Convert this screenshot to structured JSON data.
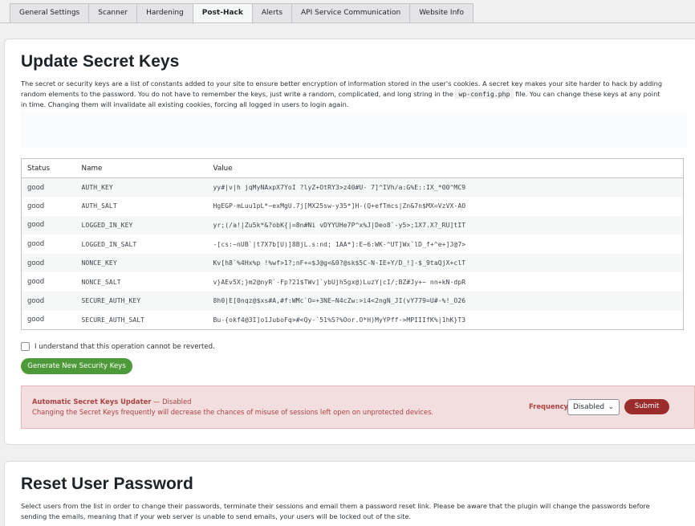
{
  "tabs": [
    {
      "label": "General Settings"
    },
    {
      "label": "Scanner"
    },
    {
      "label": "Hardening"
    },
    {
      "label": "Post-Hack"
    },
    {
      "label": "Alerts"
    },
    {
      "label": "API Service Communication"
    },
    {
      "label": "Website Info"
    }
  ],
  "active_tab": "Post-Hack",
  "secret_keys": {
    "title": "Update Secret Keys",
    "desc_part1": "The secret or security keys are a list of constants added to your site to ensure better encryption of information stored in the user's cookies. A secret key makes your site harder to hack by adding random elements to the password. You do not have to remember the keys, just write a random, complicated, and long string in the ",
    "desc_code": "wp-config.php",
    "desc_part2": " file. You can change these keys at any point in time. Changing them will invalidate all existing cookies, forcing all logged in users to login again.",
    "columns": [
      "Status",
      "Name",
      "Value"
    ],
    "rows": [
      {
        "status": "good",
        "name": "AUTH_KEY",
        "value": "yy#|v|h jqMyNAxpX7YoI ?lyZ+OtRY3>z40#U- 7]^IVh/a:G%E::IX_*00^MC9"
      },
      {
        "status": "good",
        "name": "AUTH_SALT",
        "value": "HgEGP-mLuu1pL*~exMgU.7j[MX25sw-y35*]H-(Q+efTmcs|Zn&7n$MX=VzVX-AO"
      },
      {
        "status": "good",
        "name": "LOGGED_IN_KEY",
        "value": "yr;(/a!|Zu5k*&?obK{|=8n#Ni vDYYUHe7P^x%J|Deo8`-y5>;1X7.X?_RU]tIT"
      },
      {
        "status": "good",
        "name": "LOGGED_IN_SALT",
        "value": "-[cs:~nUB`|t7X7b[U)]8BjL.s:nd; 1AA*]:E~6:WK-^UT]Wx`lD_f+^e+]J@7>"
      },
      {
        "status": "good",
        "name": "NONCE_KEY",
        "value": "Kv[h8`%4Hx%p !%wf>1?;nF+=$J@g<&9?@sk$5C-N-IE+Y/D_!]-$_9taQjX+clT"
      },
      {
        "status": "good",
        "name": "NONCE_SALT",
        "value": "v}AEv5X;}m2@nyR`-Fp?21$TWv]`ybUjh5gx@)LuzY|cI/;BZ#Jy+~ nn+kN-dpR"
      },
      {
        "status": "good",
        "name": "SECURE_AUTH_KEY",
        "value": "8h0|E[0nqz@$xs#A,#f:WMc`O=+3NE~N4cZw:>i4<2ngN_JI(vY779=U#-%!_O26"
      },
      {
        "status": "good",
        "name": "SECURE_AUTH_SALT",
        "value": "Bu-{okf4@3I]o1JuboFq>#<Qy-`51%S?%Oor.O*H)MyYPff->MPIIIfK%|1hK}T3"
      }
    ],
    "confirm_label": "I understand that this operation cannot be reverted.",
    "generate_label": "Generate New Security Keys"
  },
  "updater": {
    "title": "Automatic Secret Keys Updater",
    "status": " — Disabled",
    "note": "Changing the Secret Keys frequently will decrease the chances of misuse of sessions left open on unprotected devices.",
    "frequency_label": "Frequency:",
    "frequency_value": "Disabled",
    "submit_label": "Submit",
    "alert_bg": "#f2dede",
    "alert_text": "#a94442",
    "submit_bg": "#9b2c2c"
  },
  "reset_password": {
    "title": "Reset User Password",
    "desc": "Select users from the list in order to change their passwords, terminate their sessions and email them a password reset link. Please be aware that the plugin will change the passwords before sending the emails, meaning that if your web server is unable to send emails, your users will be locked out of the site."
  },
  "colors": {
    "accent_green": "#4e9a3a",
    "page_bg": "#f0f0f1"
  }
}
